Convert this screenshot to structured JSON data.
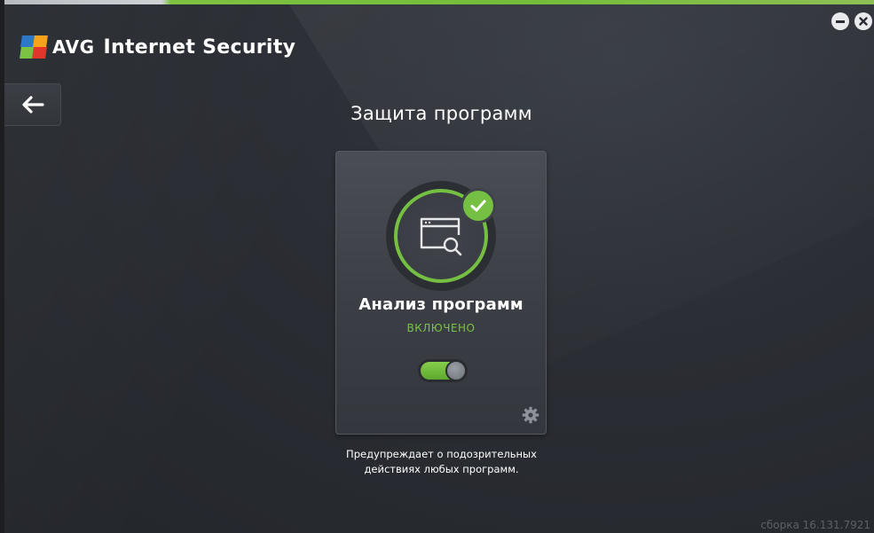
{
  "app": {
    "brand": "AVG",
    "product": "Internet Security"
  },
  "window_controls": {
    "minimize_icon": "minus-icon",
    "close_icon": "close-icon"
  },
  "navigation": {
    "back_icon": "arrow-left-icon"
  },
  "page": {
    "title": "Защита программ"
  },
  "card": {
    "icon": "window-search-icon",
    "badge_icon": "check-icon",
    "title": "Анализ программ",
    "status": "ВКЛЮЧЕНО",
    "toggle_on": true,
    "settings_icon": "gear-icon"
  },
  "description": {
    "line1": "Предупреждает о подозрительных",
    "line2": "действиях любых программ."
  },
  "footer": {
    "build": "сборка 16.131.7921"
  },
  "colors": {
    "accent_green": "#75c043",
    "background": "#2a2d33"
  }
}
